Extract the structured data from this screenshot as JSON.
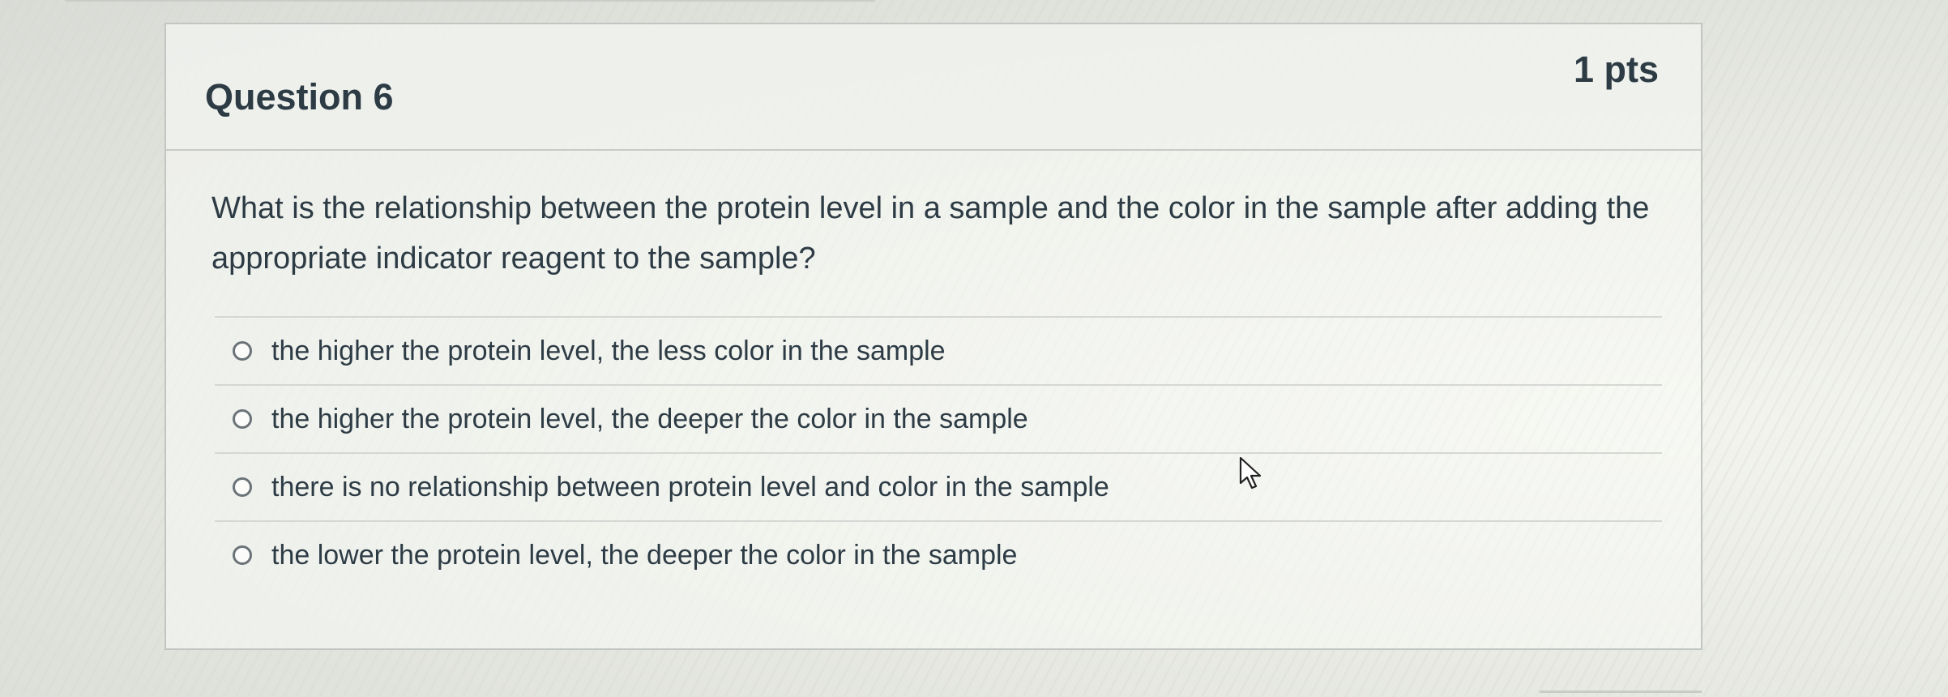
{
  "question": {
    "title": "Question 6",
    "points": "1 pts",
    "text": "What is the relationship between the protein level in a sample and the color in the sample after adding the appropriate indicator reagent to the sample?",
    "answers": [
      {
        "label": "the higher the protein level, the less color in the sample"
      },
      {
        "label": "the higher the protein level, the deeper the color in the sample"
      },
      {
        "label": "there is no relationship between protein level and color in the sample"
      },
      {
        "label": "the lower the protein level, the deeper the color in the sample"
      }
    ]
  },
  "icons": {
    "radio": "radio-button-icon",
    "cursor": "mouse-pointer-icon"
  },
  "colors": {
    "text": "#2d3b45",
    "border": "#c2c6c3"
  }
}
